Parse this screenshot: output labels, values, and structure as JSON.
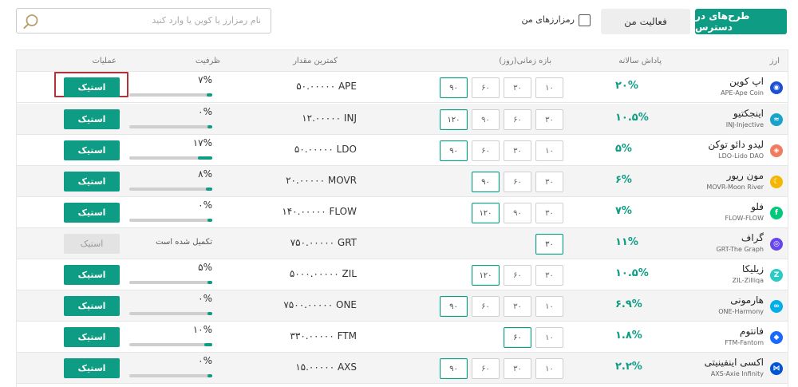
{
  "tabs": {
    "available": "طرح‌های در دسترس",
    "activity": "فعالیت من"
  },
  "filter": {
    "my_coins_label": "رمزارزهای من"
  },
  "search": {
    "placeholder": "نام رمزارز یا کوین یا وارد کنید"
  },
  "table": {
    "headers": {
      "from": "ارز",
      "apr": "پاداش سالانه",
      "period": "بازه زمانی(روز)",
      "min_amount": "کمترین مقدار",
      "capacity": "ظرفیت",
      "actions": "عملیات"
    },
    "stake_label": "استیک",
    "completed_label": "تکمیل شده است",
    "rows": [
      {
        "name": "اپ کوین",
        "symbol": "APE-Ape Coin",
        "apr": "۲۰%",
        "periods": [
          "۱۰",
          "۳۰",
          "۶۰",
          "۹۰"
        ],
        "active": 3,
        "min": "۵۰.۰۰۰۰۰ APE",
        "cap": "۷%",
        "cap_fill": 0.07,
        "completed": false,
        "icon_color": "#1d4fd6",
        "icon_glyph": "◉"
      },
      {
        "name": "اینجکتیو",
        "symbol": "INJ-Injective",
        "apr": "۱۰.۵%",
        "periods": [
          "۳۰",
          "۶۰",
          "۹۰",
          "۱۲۰"
        ],
        "active": 3,
        "min": "۱۲.۰۰۰۰۰ INJ",
        "cap": "۰%",
        "cap_fill": 0.0,
        "completed": false,
        "icon_color": "#1aa3c8",
        "icon_glyph": "≈"
      },
      {
        "name": "لیدو دائو توکن",
        "symbol": "LDO-Lido DAO",
        "apr": "۵%",
        "periods": [
          "۱۰",
          "۳۰",
          "۶۰",
          "۹۰"
        ],
        "active": 3,
        "min": "۵۰.۰۰۰۰۰ LDO",
        "cap": "۱۷%",
        "cap_fill": 0.17,
        "completed": false,
        "icon_color": "#f07b5e",
        "icon_glyph": "◈"
      },
      {
        "name": "مون ریور",
        "symbol": "MOVR-Moon River",
        "apr": "۶%",
        "periods": [
          "۳۰",
          "۶۰",
          "۹۰"
        ],
        "active": 2,
        "min": "۲۰.۰۰۰۰۰ MOVR",
        "cap": "۸%",
        "cap_fill": 0.08,
        "completed": false,
        "icon_color": "#f2b705",
        "icon_glyph": "☾"
      },
      {
        "name": "فلو",
        "symbol": "FLOW-FLOW",
        "apr": "۷%",
        "periods": [
          "۳۰",
          "۹۰",
          "۱۲۰"
        ],
        "active": 2,
        "min": "۱۴۰.۰۰۰۰۰ FLOW",
        "cap": "۰%",
        "cap_fill": 0.0,
        "completed": false,
        "icon_color": "#00c97b",
        "icon_glyph": "f"
      },
      {
        "name": "گراف",
        "symbol": "GRT-The Graph",
        "apr": "۱۱%",
        "periods": [
          "۳۰"
        ],
        "active": 0,
        "min": "۷۵۰.۰۰۰۰۰ GRT",
        "cap": "",
        "cap_fill": 1.0,
        "completed": true,
        "icon_color": "#6747ed",
        "icon_glyph": "◎"
      },
      {
        "name": "زیلیکا",
        "symbol": "ZIL-Zilliqa",
        "apr": "۱۰.۵%",
        "periods": [
          "۳۰",
          "۶۰",
          "۱۲۰"
        ],
        "active": 2,
        "min": "۵۰۰۰.۰۰۰۰۰ ZIL",
        "cap": "۵%",
        "cap_fill": 0.05,
        "completed": false,
        "icon_color": "#29ccc4",
        "icon_glyph": "Z"
      },
      {
        "name": "هارمونی",
        "symbol": "ONE-Harmony",
        "apr": "۶.۹%",
        "periods": [
          "۱۰",
          "۳۰",
          "۶۰",
          "۹۰"
        ],
        "active": 3,
        "min": "۷۵۰۰.۰۰۰۰۰ ONE",
        "cap": "۰%",
        "cap_fill": 0.0,
        "completed": false,
        "icon_color": "#00aee9",
        "icon_glyph": "∞"
      },
      {
        "name": "فانتوم",
        "symbol": "FTM-Fantom",
        "apr": "۱.۸%",
        "periods": [
          "۱۰",
          "۶۰"
        ],
        "active": 1,
        "min": "۳۳۰.۰۰۰۰۰ FTM",
        "cap": "۱۰%",
        "cap_fill": 0.1,
        "completed": false,
        "icon_color": "#1969ff",
        "icon_glyph": "◆"
      },
      {
        "name": "اکسی اینفینیتی",
        "symbol": "AXS-Axie Infinity",
        "apr": "۲.۲%",
        "periods": [
          "۱۰",
          "۳۰",
          "۶۰",
          "۹۰"
        ],
        "active": 3,
        "min": "۱۵.۰۰۰۰۰ AXS",
        "cap": "۰%",
        "cap_fill": 0.0,
        "completed": false,
        "icon_color": "#0055d5",
        "icon_glyph": "⋈"
      }
    ]
  }
}
